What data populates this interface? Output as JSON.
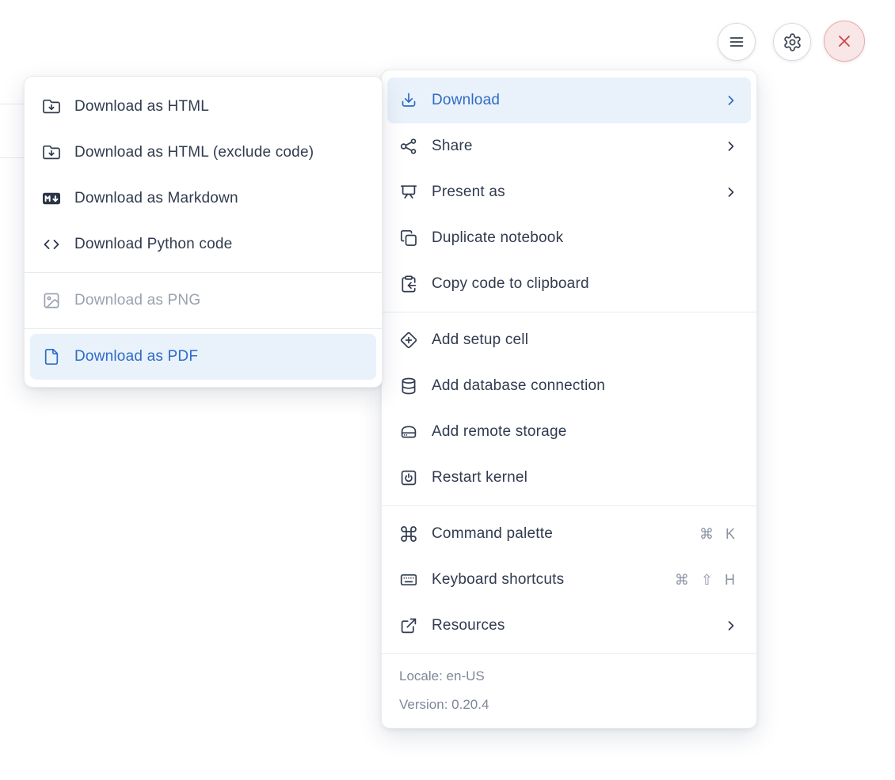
{
  "toolbar": {
    "menu_button": {
      "icon": "hamburger-icon"
    },
    "settings_button": {
      "icon": "gear-icon"
    },
    "close_button": {
      "icon": "close-icon"
    }
  },
  "main_menu": {
    "items": [
      {
        "label": "Download",
        "icon": "download-icon",
        "state": "active",
        "has_submenu": true
      },
      {
        "label": "Share",
        "icon": "share-icon",
        "has_submenu": true
      },
      {
        "label": "Present as",
        "icon": "presentation-icon",
        "has_submenu": true
      },
      {
        "label": "Duplicate notebook",
        "icon": "copy-icon"
      },
      {
        "label": "Copy code to clipboard",
        "icon": "clipboard-copy-icon"
      },
      {
        "label": "Add setup cell",
        "icon": "diamond-plus-icon"
      },
      {
        "label": "Add database connection",
        "icon": "database-icon"
      },
      {
        "label": "Add remote storage",
        "icon": "hard-drive-icon"
      },
      {
        "label": "Restart kernel",
        "icon": "power-square-icon"
      },
      {
        "label": "Command palette",
        "icon": "command-icon",
        "shortcut": "⌘ K"
      },
      {
        "label": "Keyboard shortcuts",
        "icon": "keyboard-icon",
        "shortcut": "⌘ ⇧ H"
      },
      {
        "label": "Resources",
        "icon": "external-link-icon",
        "has_submenu": true
      }
    ],
    "footer": {
      "locale": "Locale: en-US",
      "version": "Version: 0.20.4"
    }
  },
  "submenu": {
    "items": [
      {
        "label": "Download as HTML",
        "icon": "folder-down-icon"
      },
      {
        "label": "Download as HTML (exclude code)",
        "icon": "folder-down-icon"
      },
      {
        "label": "Download as Markdown",
        "icon": "markdown-icon"
      },
      {
        "label": "Download Python code",
        "icon": "code-icon"
      },
      {
        "label": "Download as PNG",
        "icon": "image-icon",
        "state": "disabled"
      },
      {
        "label": "Download as PDF",
        "icon": "file-icon",
        "state": "active"
      }
    ]
  },
  "colors": {
    "accent_blue": "#2f6cc4",
    "highlight_bg": "#e9f1fb",
    "text": "#313b4f",
    "muted_text": "#8b93a2",
    "disabled_text": "#9aa2b0",
    "divider": "#e7eaee",
    "danger": "#ce4747",
    "danger_bg": "#f9e6e6",
    "danger_border": "#e9abab"
  }
}
